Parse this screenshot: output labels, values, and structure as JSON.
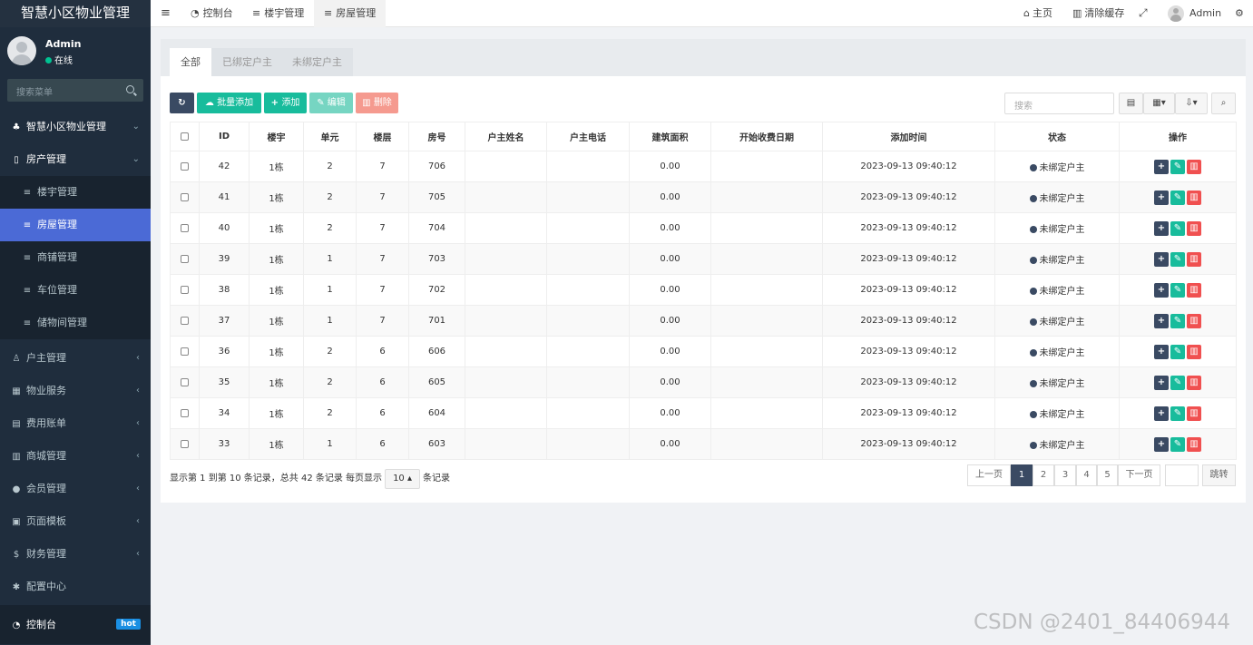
{
  "sidebar": {
    "brand": "智慧小区物业管理",
    "user_name": "Admin",
    "user_status": "在线",
    "search_placeholder": "搜索菜单",
    "menu": [
      {
        "label": "智慧小区物业管理",
        "icon": "cubes-icon",
        "chev": "⌄"
      },
      {
        "label": "房产管理",
        "icon": "building-icon",
        "chev": "⌄"
      },
      {
        "label": "楼宇管理",
        "icon": "list-icon"
      },
      {
        "label": "房屋管理",
        "icon": "list-icon"
      },
      {
        "label": "商铺管理",
        "icon": "list-icon"
      },
      {
        "label": "车位管理",
        "icon": "list-icon"
      },
      {
        "label": "储物间管理",
        "icon": "list-icon"
      },
      {
        "label": "户主管理",
        "icon": "user-icon",
        "chev": "‹"
      },
      {
        "label": "物业服务",
        "icon": "service-icon",
        "chev": "‹"
      },
      {
        "label": "费用账单",
        "icon": "bill-icon",
        "chev": "‹"
      },
      {
        "label": "商城管理",
        "icon": "shop-icon",
        "chev": "‹"
      },
      {
        "label": "会员管理",
        "icon": "member-icon",
        "chev": "‹"
      },
      {
        "label": "页面模板",
        "icon": "template-icon",
        "chev": "‹"
      },
      {
        "label": "财务管理",
        "icon": "dollar-icon",
        "chev": "‹"
      },
      {
        "label": "配置中心",
        "icon": "gear-icon"
      }
    ],
    "bottom_item": {
      "label": "控制台",
      "badge": "hot"
    }
  },
  "topbar": {
    "tabs": [
      "控制台",
      "楼宇管理",
      "房屋管理"
    ],
    "active_tab": "房屋管理",
    "home": "主页",
    "clear_cache": "清除缓存",
    "user": "Admin"
  },
  "panel": {
    "tabs": [
      "全部",
      "已绑定户主",
      "未绑定户主"
    ],
    "active_tab": "全部",
    "toolbar": {
      "batch_add": "批量添加",
      "add": "添加",
      "edit": "编辑",
      "delete": "删除",
      "search_placeholder": "搜索"
    },
    "columns": [
      "ID",
      "楼宇",
      "单元",
      "楼层",
      "房号",
      "户主姓名",
      "户主电话",
      "建筑面积",
      "开始收费日期",
      "添加时间",
      "状态",
      "操作"
    ],
    "rows": [
      {
        "id": "42",
        "building": "1栋",
        "unit": "2",
        "floor": "7",
        "room": "706",
        "owner": "",
        "phone": "",
        "area": "0.00",
        "start": "",
        "added": "2023-09-13 09:40:12",
        "status": "未绑定户主"
      },
      {
        "id": "41",
        "building": "1栋",
        "unit": "2",
        "floor": "7",
        "room": "705",
        "owner": "",
        "phone": "",
        "area": "0.00",
        "start": "",
        "added": "2023-09-13 09:40:12",
        "status": "未绑定户主"
      },
      {
        "id": "40",
        "building": "1栋",
        "unit": "2",
        "floor": "7",
        "room": "704",
        "owner": "",
        "phone": "",
        "area": "0.00",
        "start": "",
        "added": "2023-09-13 09:40:12",
        "status": "未绑定户主"
      },
      {
        "id": "39",
        "building": "1栋",
        "unit": "1",
        "floor": "7",
        "room": "703",
        "owner": "",
        "phone": "",
        "area": "0.00",
        "start": "",
        "added": "2023-09-13 09:40:12",
        "status": "未绑定户主"
      },
      {
        "id": "38",
        "building": "1栋",
        "unit": "1",
        "floor": "7",
        "room": "702",
        "owner": "",
        "phone": "",
        "area": "0.00",
        "start": "",
        "added": "2023-09-13 09:40:12",
        "status": "未绑定户主"
      },
      {
        "id": "37",
        "building": "1栋",
        "unit": "1",
        "floor": "7",
        "room": "701",
        "owner": "",
        "phone": "",
        "area": "0.00",
        "start": "",
        "added": "2023-09-13 09:40:12",
        "status": "未绑定户主"
      },
      {
        "id": "36",
        "building": "1栋",
        "unit": "2",
        "floor": "6",
        "room": "606",
        "owner": "",
        "phone": "",
        "area": "0.00",
        "start": "",
        "added": "2023-09-13 09:40:12",
        "status": "未绑定户主"
      },
      {
        "id": "35",
        "building": "1栋",
        "unit": "2",
        "floor": "6",
        "room": "605",
        "owner": "",
        "phone": "",
        "area": "0.00",
        "start": "",
        "added": "2023-09-13 09:40:12",
        "status": "未绑定户主"
      },
      {
        "id": "34",
        "building": "1栋",
        "unit": "2",
        "floor": "6",
        "room": "604",
        "owner": "",
        "phone": "",
        "area": "0.00",
        "start": "",
        "added": "2023-09-13 09:40:12",
        "status": "未绑定户主"
      },
      {
        "id": "33",
        "building": "1栋",
        "unit": "1",
        "floor": "6",
        "room": "603",
        "owner": "",
        "phone": "",
        "area": "0.00",
        "start": "",
        "added": "2023-09-13 09:40:12",
        "status": "未绑定户主"
      }
    ],
    "pagination": {
      "info_before": "显示第 1 到第 10 条记录，总共 42 条记录 每页显示",
      "page_size": "10 ▴",
      "info_after": "条记录",
      "prev": "上一页",
      "pages": [
        "1",
        "2",
        "3",
        "4",
        "5"
      ],
      "current": "1",
      "next": "下一页",
      "jump": "跳转"
    }
  },
  "watermark": "CSDN @2401_84406944",
  "colors": {
    "sidebar_bg": "#1f2d3d",
    "accent": "#4b6ad6",
    "primary": "#3a4a63",
    "success": "#18bc9c",
    "danger": "#f05050"
  }
}
